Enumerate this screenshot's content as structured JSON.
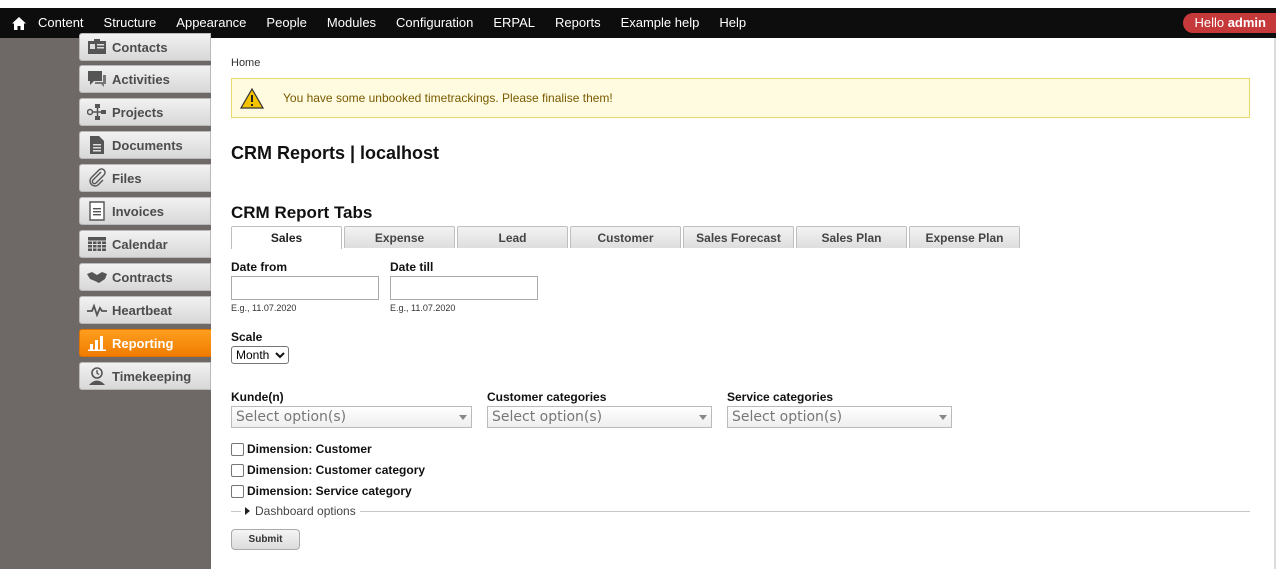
{
  "toolbar": {
    "items": [
      "Content",
      "Structure",
      "Appearance",
      "People",
      "Modules",
      "Configuration",
      "ERPAL",
      "Reports",
      "Example help",
      "Help"
    ],
    "hello_prefix": "Hello",
    "hello_user": "admin"
  },
  "sidebar": {
    "items": [
      {
        "label": "Contacts",
        "icon": "contacts-icon"
      },
      {
        "label": "Activities",
        "icon": "activities-icon"
      },
      {
        "label": "Projects",
        "icon": "projects-icon"
      },
      {
        "label": "Documents",
        "icon": "documents-icon"
      },
      {
        "label": "Files",
        "icon": "paperclip-icon"
      },
      {
        "label": "Invoices",
        "icon": "invoices-icon"
      },
      {
        "label": "Calendar",
        "icon": "calendar-icon"
      },
      {
        "label": "Contracts",
        "icon": "handshake-icon"
      },
      {
        "label": "Heartbeat",
        "icon": "heartbeat-icon"
      },
      {
        "label": "Reporting",
        "icon": "bar-chart-icon",
        "active": true
      },
      {
        "label": "Timekeeping",
        "icon": "user-clock-icon"
      }
    ],
    "active_color": "#f28200"
  },
  "breadcrumb": "Home",
  "warning": "You have some unbooked timetrackings. Please finalise them!",
  "page_title": "CRM Reports | localhost",
  "section_title": "CRM Report Tabs",
  "tabs": [
    "Sales",
    "Expense",
    "Lead",
    "Customer",
    "Sales Forecast",
    "Sales Plan",
    "Expense Plan"
  ],
  "active_tab": "Sales",
  "form": {
    "date_from_label": "Date from",
    "date_from_value": "",
    "date_from_hint": "E.g., 11.07.2020",
    "date_till_label": "Date till",
    "date_till_value": "",
    "date_till_hint": "E.g., 11.07.2020",
    "scale_label": "Scale",
    "scale_value": "Month",
    "kunden_label": "Kunde(n)",
    "kunden_placeholder": "Select option(s)",
    "customer_cat_label": "Customer categories",
    "customer_cat_placeholder": "Select option(s)",
    "service_cat_label": "Service categories",
    "service_cat_placeholder": "Select option(s)",
    "checkboxes": [
      "Dimension: Customer",
      "Dimension: Customer category",
      "Dimension: Service category"
    ],
    "dashboard_options": "Dashboard options",
    "submit": "Submit"
  }
}
